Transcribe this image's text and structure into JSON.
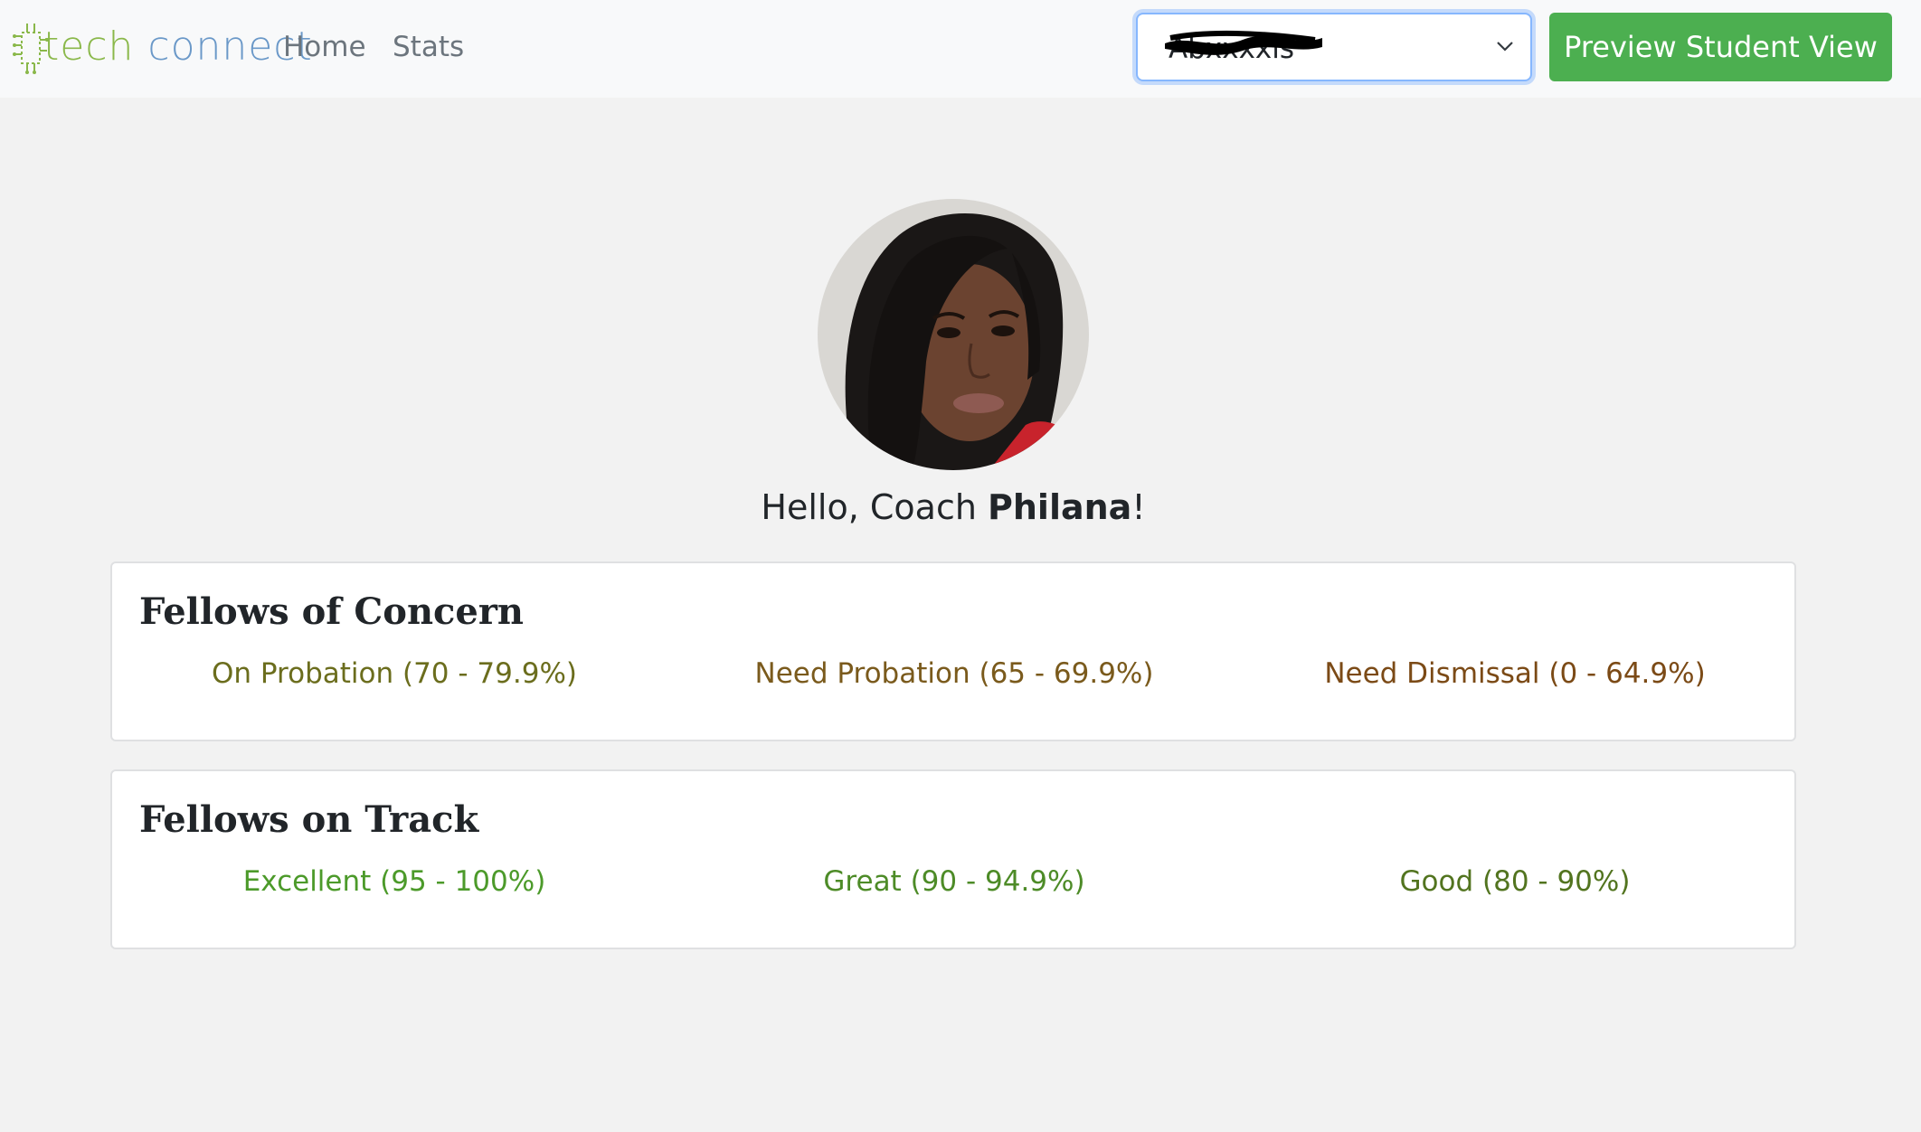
{
  "nav": {
    "logo": {
      "part1": "tech",
      "part2": "connect"
    },
    "links": [
      "Home",
      "Stats"
    ],
    "student_select_value": "Abxxxxis",
    "preview_button": "Preview Student View"
  },
  "profile": {
    "greeting_prefix": "Hello, Coach ",
    "name": "Philana",
    "greeting_suffix": "!"
  },
  "cards": {
    "concern": {
      "title": "Fellows of Concern",
      "items": [
        {
          "label": "On Probation (70 - 79.9%)",
          "color": "#6b6d1d"
        },
        {
          "label": "Need Probation (65 - 69.9%)",
          "color": "#7a5a1c"
        },
        {
          "label": "Need Dismissal (0 - 64.9%)",
          "color": "#7b4a16"
        }
      ]
    },
    "track": {
      "title": "Fellows on Track",
      "items": [
        {
          "label": "Excellent (95 - 100%)",
          "color": "#4c9a2a"
        },
        {
          "label": "Great (90 - 94.9%)",
          "color": "#4d8b27"
        },
        {
          "label": "Good (80 - 90%)",
          "color": "#52741f"
        }
      ]
    }
  }
}
